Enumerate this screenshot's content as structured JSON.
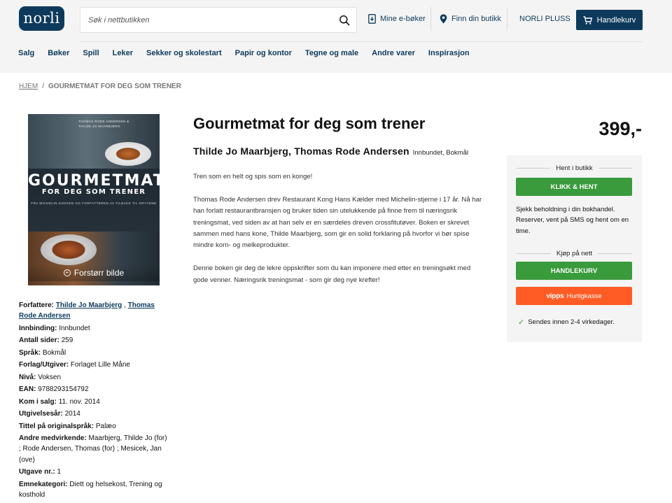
{
  "header": {
    "logo": "norli",
    "search_placeholder": "Søk i nettbutikken",
    "links": {
      "ebooks": "Mine e-bøker",
      "store": "Finn din butikk",
      "plus": "NORLI PLUSS",
      "cart": "Handlekurv"
    },
    "nav": [
      "Salg",
      "Bøker",
      "Spill",
      "Leker",
      "Sekker og skolestart",
      "Papir og kontor",
      "Tegne og male",
      "Andre varer",
      "Inspirasjon"
    ]
  },
  "breadcrumb": {
    "home": "HJEM",
    "separator": "/",
    "current": "GOURMETMAT FOR DEG SOM TRENER"
  },
  "cover": {
    "title": "GOURMETMAT",
    "subtitle": "FOR DEG SOM TRENER",
    "tagline": "FRA MICHELIN-KOKKEN OG FORFATTEREN AV TILBAKE TIL GRYTENE",
    "authors_line1": "THOMAS RODE ANDERSEN &",
    "authors_line2": "THILDE JO MAARBJERG",
    "enlarge": "Forstørr bilde"
  },
  "product": {
    "title": "Gourmetmat for deg som trener",
    "authors": "Thilde Jo Maarbjerg, Thomas Rode Andersen",
    "format": "Innbundet, Bokmål",
    "description": [
      "Tren som en helt og spis som en konge!",
      "Thomas Rode Andersen drev Restaurant Kong Hans Kælder med Michelin-stjerne i 17 år. Nå har han forlatt restaurantbransjen og bruker tiden sin utelukkende på finne frem til næringsrik treningsmat, ved siden av at han selv er en særdeles dreven crossfitutøver. Boken er skrevet sammen med hans kone, Thilde Maarbjerg, som gir en solid forklaring på hvorfor vi bør spise mindre korn- og melkeprodukter.",
      "Denne boken gir deg de lekre oppskrifter som du kan imponere med etter en treningsøkt med gode venner. Næringsrik treningsmat - som gir deg nye krefter!"
    ],
    "price": "399,-"
  },
  "details": {
    "authors_label": "Forfattere:",
    "author1": "Thilde Jo Maarbjerg",
    "author_sep": ",",
    "author2": "Thomas Rode Andersen",
    "rows": [
      {
        "label": "Innbinding:",
        "value": "Innbundet"
      },
      {
        "label": "Antall sider:",
        "value": "259"
      },
      {
        "label": "Språk:",
        "value": "Bokmål"
      },
      {
        "label": "Forlag/Utgiver:",
        "value": "Forlaget Lille Måne"
      },
      {
        "label": "Nivå:",
        "value": "Voksen"
      },
      {
        "label": "EAN:",
        "value": "9788293154792"
      },
      {
        "label": "Kom i salg:",
        "value": "11. nov. 2014"
      },
      {
        "label": "Utgivelsesår:",
        "value": "2014"
      },
      {
        "label": "Tittel på originalspråk:",
        "value": "Palæo"
      },
      {
        "label": "Andre medvirkende:",
        "value": "Maarbjerg, Thilde Jo (for) ; Rode Andersen, Thomas (for) ; Mesicek, Jan (ove)"
      },
      {
        "label": "Utgave nr.:",
        "value": "1"
      },
      {
        "label": "Emnekategori:",
        "value": "Diett og helsekost, Trening og kosthold"
      }
    ]
  },
  "sidebox": {
    "store_heading": "Hent i butikk",
    "click_collect": "KLIKK & HENT",
    "store_note": "Sjekk beholdning i din bokhandel. Reserver, vent på SMS og hent om en time.",
    "online_heading": "Kjøp på nett",
    "add_to_cart": "HANDLEKURV",
    "vipps_logo": "vipps",
    "vipps_label": "Hurtigkasse",
    "shipping": "Sendes innen 2-4 virkedager."
  },
  "colors": {
    "brand": "#0d3a5c",
    "green": "#3a9b3c",
    "vipps": "#ff5b24",
    "header_bg": "#f4f4f4"
  }
}
